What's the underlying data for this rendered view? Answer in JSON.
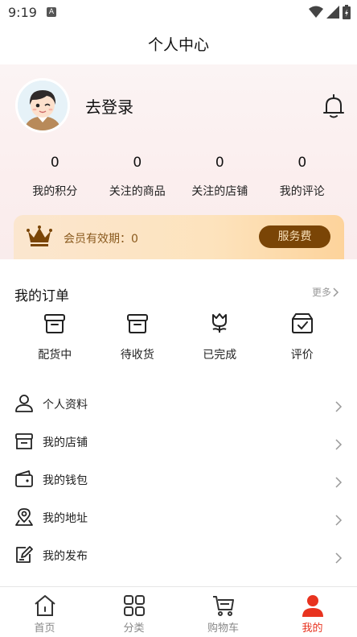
{
  "status_bar": {
    "time": "9:19",
    "notification_badge": "A"
  },
  "header": {
    "title": "个人中心"
  },
  "profile": {
    "login_text": "去登录"
  },
  "stats": [
    {
      "value": "0",
      "label": "我的积分"
    },
    {
      "value": "0",
      "label": "关注的商品"
    },
    {
      "value": "0",
      "label": "关注的店铺"
    },
    {
      "value": "0",
      "label": "我的评论"
    }
  ],
  "vip": {
    "label": "会员有效期：0",
    "button": "服务费"
  },
  "orders": {
    "title": "我的订单",
    "more": "更多",
    "items": [
      {
        "label": "配货中",
        "icon": "box-icon"
      },
      {
        "label": "待收货",
        "icon": "package-icon"
      },
      {
        "label": "已完成",
        "icon": "flower-icon"
      },
      {
        "label": "评价",
        "icon": "review-box-icon"
      }
    ]
  },
  "menu": [
    {
      "label": "个人资料",
      "icon": "user-icon"
    },
    {
      "label": "我的店铺",
      "icon": "store-icon"
    },
    {
      "label": "我的钱包",
      "icon": "wallet-icon"
    },
    {
      "label": "我的地址",
      "icon": "location-icon"
    },
    {
      "label": "我的发布",
      "icon": "edit-icon"
    }
  ],
  "tabs": [
    {
      "label": "首页",
      "icon": "home-icon",
      "active": false
    },
    {
      "label": "分类",
      "icon": "grid-icon",
      "active": false
    },
    {
      "label": "购物车",
      "icon": "cart-icon",
      "active": false
    },
    {
      "label": "我的",
      "icon": "profile-icon",
      "active": true
    }
  ],
  "colors": {
    "accent": "#e8331f",
    "vip_button": "#7a4506",
    "vip_text": "#8a5a1e"
  }
}
